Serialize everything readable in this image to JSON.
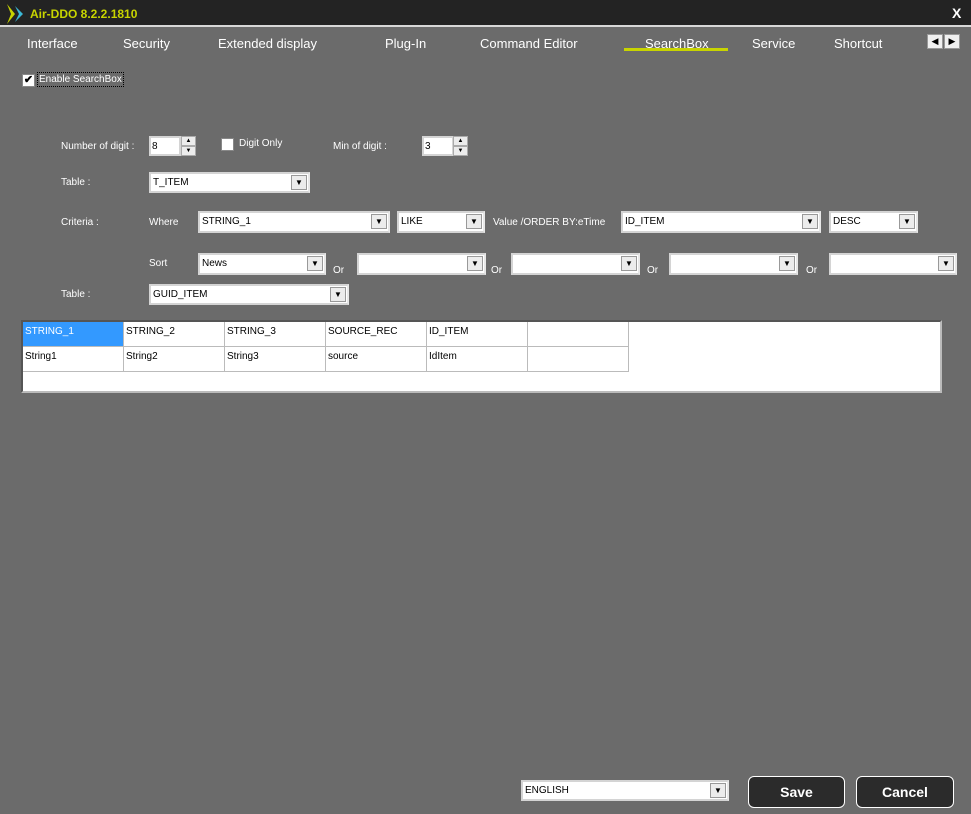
{
  "window": {
    "title": "Air-DDO 8.2.2.1810",
    "close_label": "X"
  },
  "tabs": [
    {
      "label": "Interface"
    },
    {
      "label": "Security"
    },
    {
      "label": "Extended display"
    },
    {
      "label": "Plug-In"
    },
    {
      "label": "Command Editor"
    },
    {
      "label": "SearchBox",
      "active": true
    },
    {
      "label": "Service"
    },
    {
      "label": "Shortcut"
    }
  ],
  "tab_scroll": {
    "left": "◀",
    "right": "▶"
  },
  "enable": {
    "label": "Enable SearchBox",
    "checked": true,
    "mark": "✔"
  },
  "form": {
    "number_of_digit_label": "Number of digit :",
    "number_of_digit": "8",
    "digit_only_label": "Digit Only",
    "digit_only": false,
    "min_of_digit_label": "Min of digit :",
    "min_of_digit": "3",
    "table_label": "Table :",
    "table": "T_ITEM",
    "criteria_label": "Criteria :",
    "where_label": "Where",
    "where_field": "STRING_1",
    "operator": "LIKE",
    "value_order_label": "Value /ORDER BY:eTime",
    "order_field": "ID_ITEM",
    "order_dir": "DESC",
    "sort_label": "Sort",
    "sort": [
      "News",
      "",
      "",
      "",
      ""
    ],
    "or_label": "Or",
    "table2_label": "Table :",
    "table2": "GUID_ITEM"
  },
  "grid": {
    "headers": [
      "STRING_1",
      "STRING_2",
      "STRING_3",
      "SOURCE_REC",
      "ID_ITEM",
      ""
    ],
    "rows": [
      [
        "String1",
        "String2",
        "String3",
        "source",
        "IdItem",
        ""
      ]
    ]
  },
  "footer": {
    "language": "ENGLISH",
    "save": "Save",
    "cancel": "Cancel"
  },
  "colors": {
    "accent": "#c8d400",
    "selection": "#3399ff",
    "background": "#6b6b6b"
  }
}
